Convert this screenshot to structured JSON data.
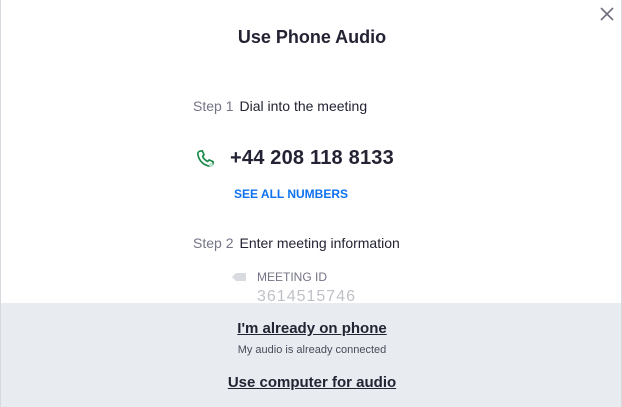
{
  "dialog": {
    "title": "Use Phone Audio",
    "close_icon": "close-icon"
  },
  "step1": {
    "number": "Step 1",
    "text": "Dial into the meeting"
  },
  "phone": {
    "icon": "phone-icon",
    "number": "+44 208 118 8133",
    "see_all_label": "SEE ALL NUMBERS"
  },
  "step2": {
    "number": "Step 2",
    "text": "Enter meeting information"
  },
  "meeting": {
    "icon": "tag-icon",
    "label": "MEETING ID",
    "id": "3614515746"
  },
  "footer": {
    "already_label": "I'm already on phone",
    "already_sub": "My audio is already connected",
    "computer_label": "Use computer for audio"
  },
  "colors": {
    "accent": "#0e72ed",
    "phone_icon": "#1a8a4a",
    "footer_bg": "#e8ecf0",
    "text": "#232333"
  }
}
